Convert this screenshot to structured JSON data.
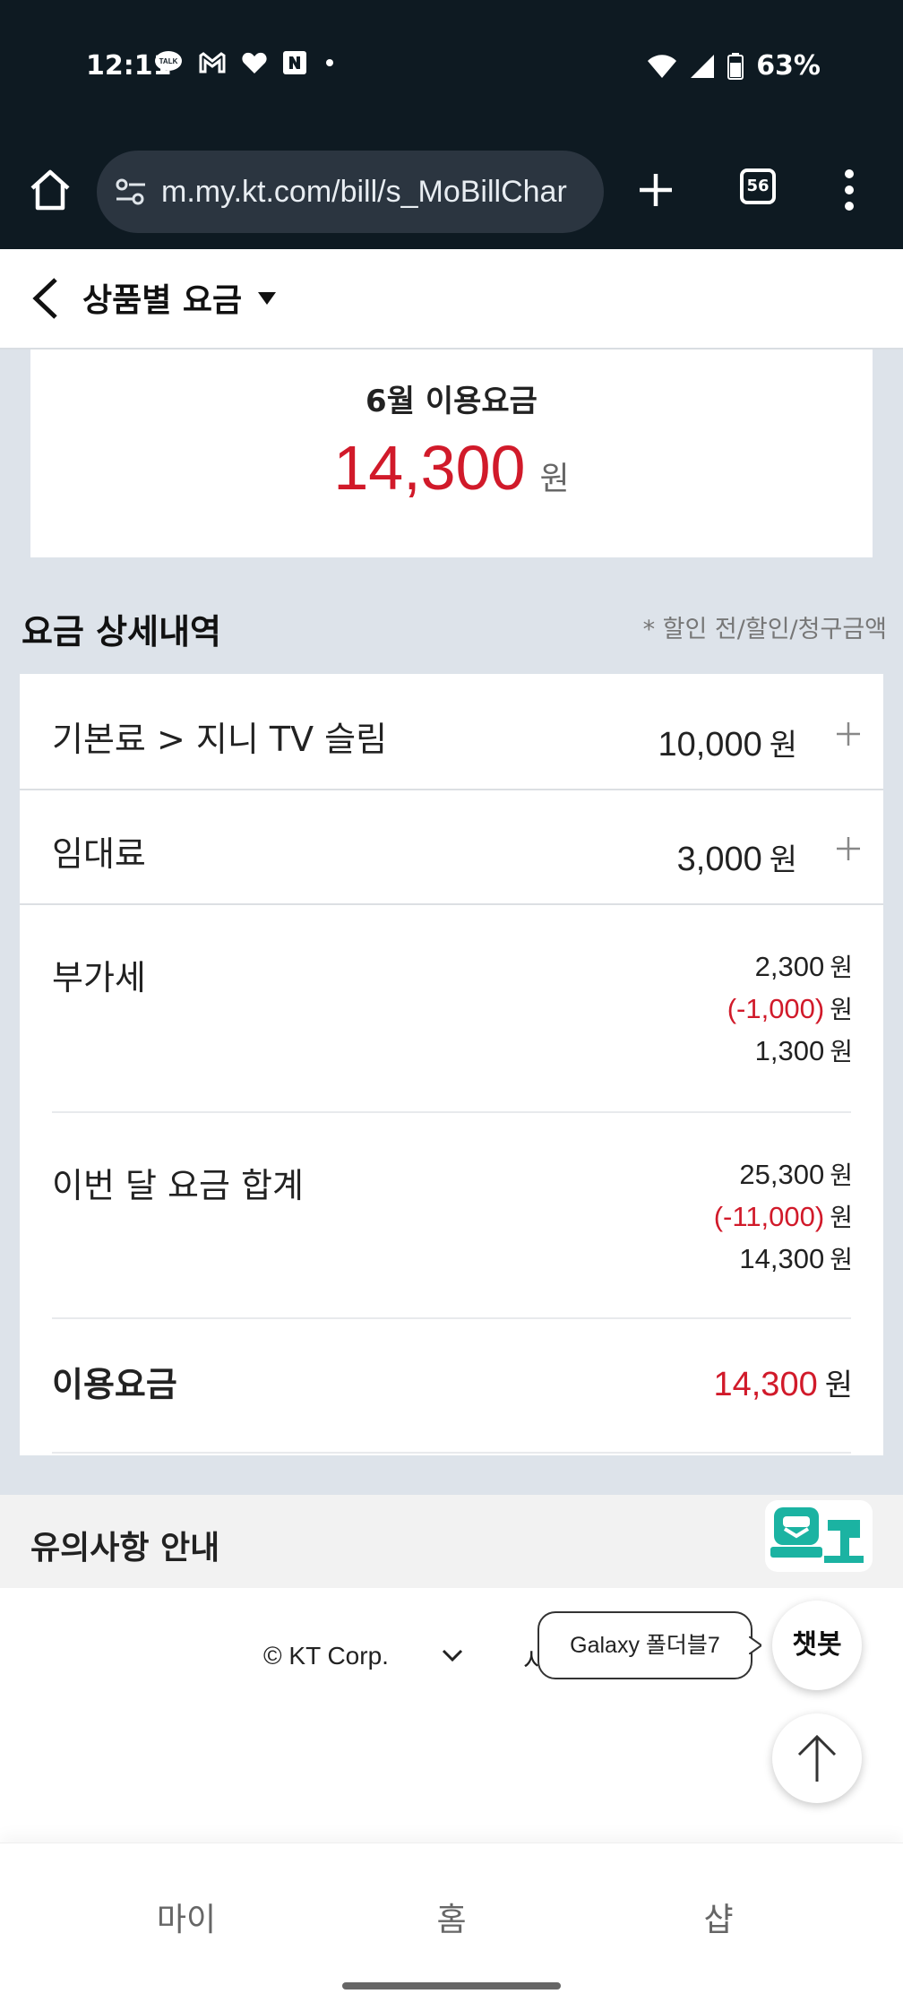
{
  "status_bar": {
    "time": "12:11",
    "battery": "63%",
    "notification_icons": [
      "talk-icon",
      "gmail-icon",
      "heart-icon",
      "naver-icon",
      "dot-icon"
    ]
  },
  "browser": {
    "url": "m.my.kt.com/bill/s_MoBillChar",
    "tab_count": "56"
  },
  "header": {
    "title": "상품별 요금"
  },
  "summary": {
    "label": "6월 이용요금",
    "amount": "14,300",
    "unit": "원"
  },
  "details": {
    "title": "요금 상세내역",
    "note": "* 할인 전/할인/청구금액",
    "rows": [
      {
        "label": "기본료 > 지니 TV 슬림",
        "value": "10,000",
        "unit": "원"
      },
      {
        "label": "임대료",
        "value": "3,000",
        "unit": "원"
      }
    ],
    "vat": {
      "label": "부가세",
      "before": "2,300",
      "discount": "(-1,000)",
      "billed": "1,300",
      "unit": "원"
    },
    "month_total": {
      "label": "이번 달 요금 합계",
      "before": "25,300",
      "discount": "(-11,000)",
      "billed": "14,300",
      "unit": "원"
    },
    "usage": {
      "label": "이용요금",
      "value": "14,300",
      "unit": "원"
    }
  },
  "notice": {
    "title": "유의사항 안내"
  },
  "footer": {
    "copyright": "© KT Corp.",
    "partial_text": "시",
    "tooltip": "Galaxy 폴더블7",
    "chatbot": "챗봇"
  },
  "bottom_nav": [
    "마이",
    "홈",
    "샵"
  ],
  "colors": {
    "accent_red": "#d11a2a",
    "status_bg": "#0e1a22",
    "teal": "#1bb3a2"
  }
}
